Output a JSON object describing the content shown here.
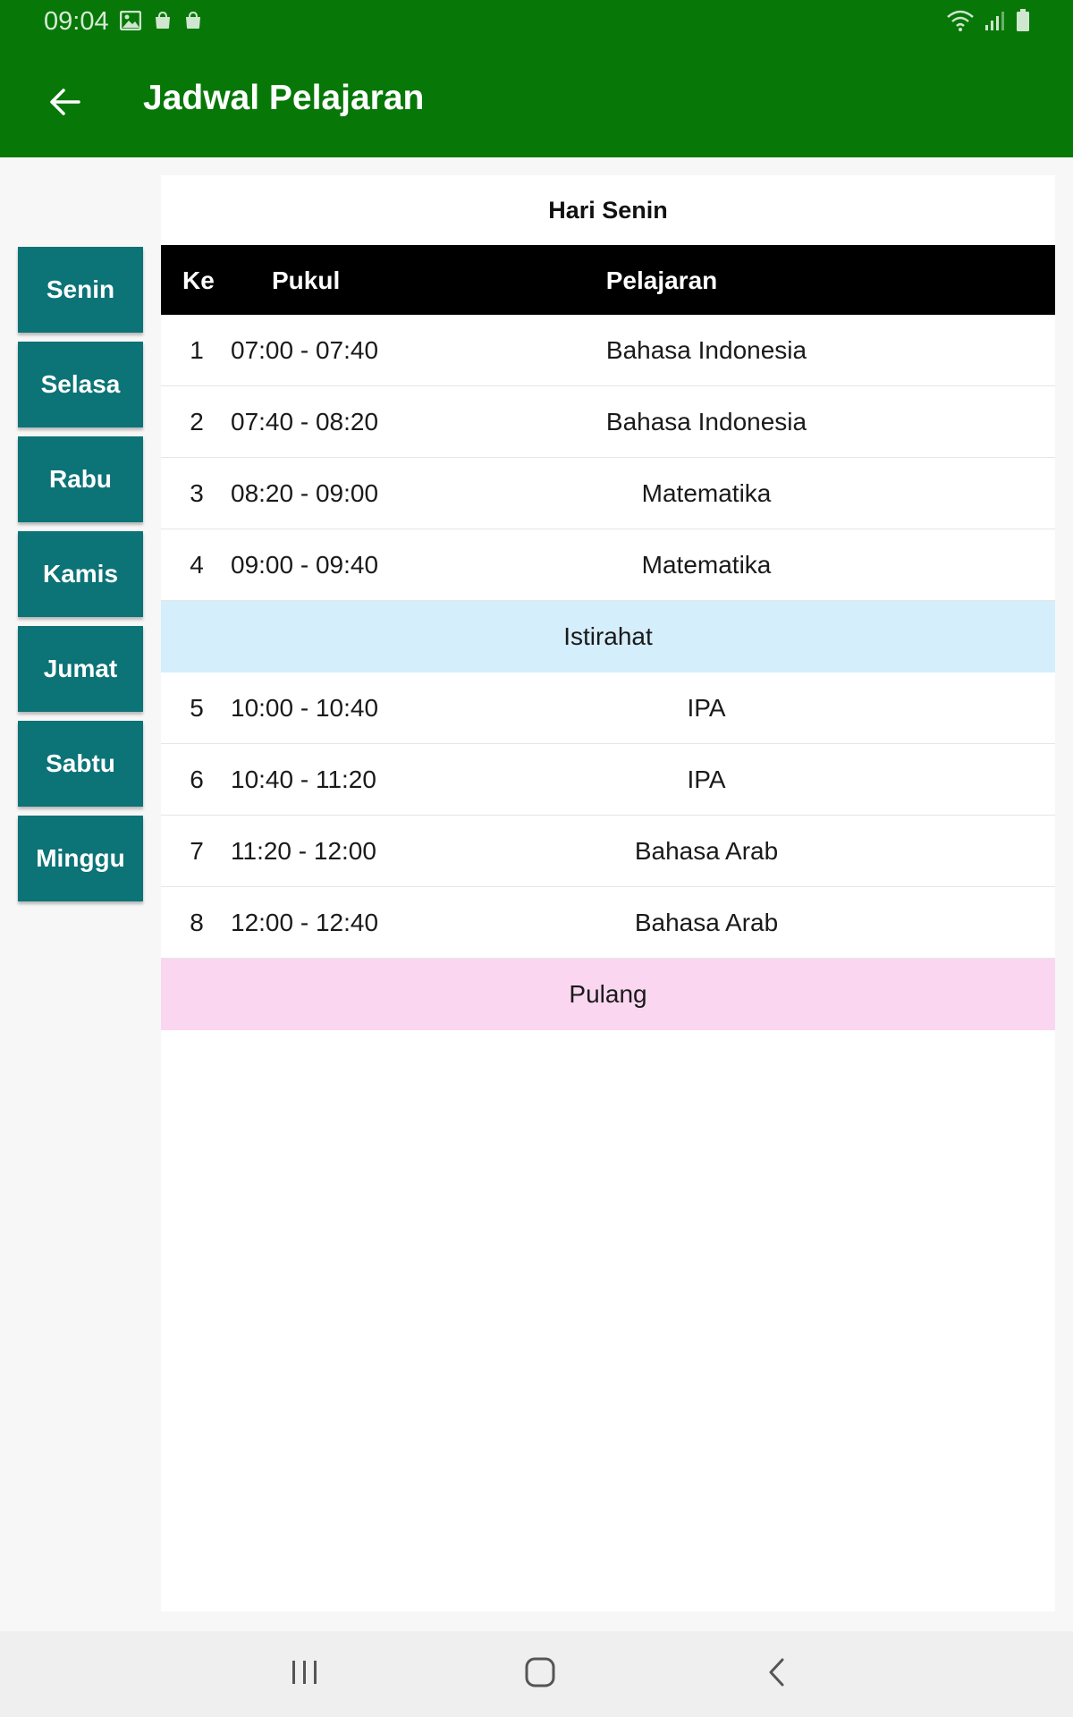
{
  "status_bar": {
    "time": "09:04",
    "left_icons": [
      "image-icon",
      "bag-icon",
      "bag-icon"
    ],
    "right_icons": [
      "wifi-icon",
      "signal-icon",
      "battery-icon"
    ]
  },
  "app_bar": {
    "title": "Jadwal Pelajaran",
    "back_icon": "arrow-left-icon",
    "color": "#077808"
  },
  "days": [
    {
      "label": "Senin"
    },
    {
      "label": "Selasa"
    },
    {
      "label": "Rabu"
    },
    {
      "label": "Kamis"
    },
    {
      "label": "Jumat"
    },
    {
      "label": "Sabtu"
    },
    {
      "label": "Minggu"
    }
  ],
  "day_button_color": "#0c7377",
  "schedule": {
    "title": "Hari Senin",
    "headers": {
      "ke": "Ke",
      "pukul": "Pukul",
      "pelajaran": "Pelajaran"
    },
    "rows": [
      {
        "ke": "1",
        "pukul": "07:00 - 07:40",
        "pelajaran": "Bahasa Indonesia"
      },
      {
        "ke": "2",
        "pukul": "07:40 - 08:20",
        "pelajaran": "Bahasa Indonesia"
      },
      {
        "ke": "3",
        "pukul": "08:20 - 09:00",
        "pelajaran": "Matematika"
      },
      {
        "ke": "4",
        "pukul": "09:00 - 09:40",
        "pelajaran": "Matematika"
      },
      {
        "ke": "5",
        "pukul": "10:00 - 10:40",
        "pelajaran": "IPA"
      },
      {
        "ke": "6",
        "pukul": "10:40 - 11:20",
        "pelajaran": "IPA"
      },
      {
        "ke": "7",
        "pukul": "11:20 - 12:00",
        "pelajaran": "Bahasa Arab"
      },
      {
        "ke": "8",
        "pukul": "12:00 - 12:40",
        "pelajaran": "Bahasa Arab"
      }
    ],
    "break_label": "Istirahat",
    "end_label": "Pulang",
    "break_color": "#d4eefc",
    "end_color": "#fbd6f0"
  },
  "nav_bar": {
    "icons": [
      "recent-apps-icon",
      "home-icon",
      "back-icon"
    ]
  }
}
